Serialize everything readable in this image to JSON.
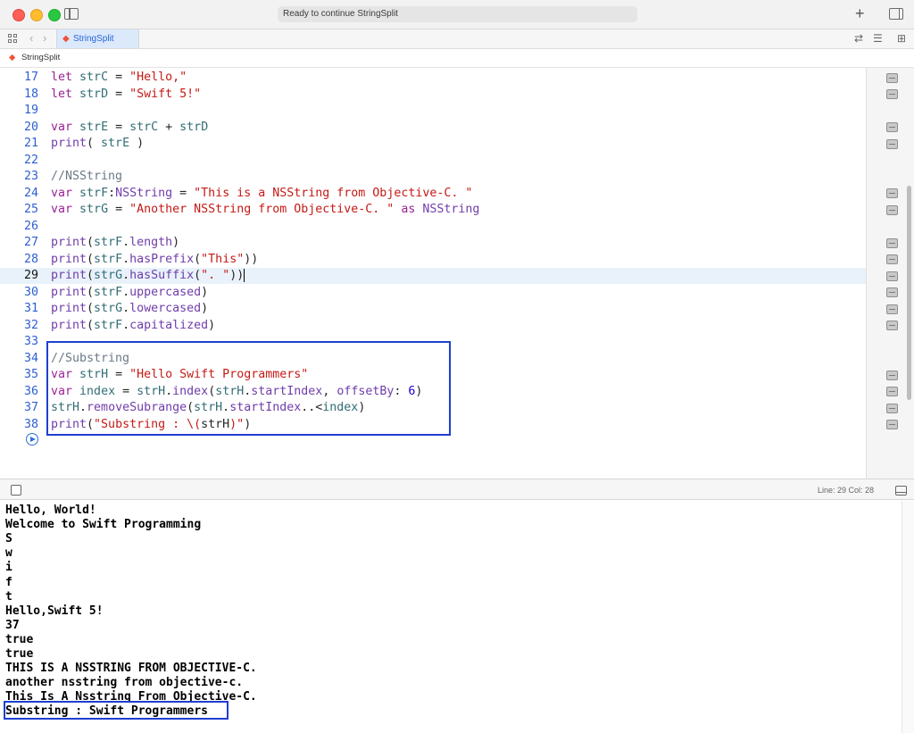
{
  "window": {
    "activity_status": "Ready to continue StringSplit",
    "tab_label": "StringSplit",
    "jump_bar": "StringSplit"
  },
  "editor": {
    "lines": [
      {
        "n": "17",
        "tokens": [
          [
            "kw",
            "let"
          ],
          [
            "p",
            " "
          ],
          [
            "id",
            "strC"
          ],
          [
            "p",
            " = "
          ],
          [
            "str",
            "\"Hello,\""
          ]
        ]
      },
      {
        "n": "18",
        "tokens": [
          [
            "kw",
            "let"
          ],
          [
            "p",
            " "
          ],
          [
            "id",
            "strD"
          ],
          [
            "p",
            " = "
          ],
          [
            "str",
            "\"Swift 5!\""
          ]
        ]
      },
      {
        "n": "19",
        "tokens": []
      },
      {
        "n": "20",
        "tokens": [
          [
            "kw",
            "var"
          ],
          [
            "p",
            " "
          ],
          [
            "id",
            "strE"
          ],
          [
            "p",
            " = "
          ],
          [
            "id",
            "strC"
          ],
          [
            "p",
            " + "
          ],
          [
            "id",
            "strD"
          ]
        ]
      },
      {
        "n": "21",
        "tokens": [
          [
            "ty",
            "print"
          ],
          [
            "p",
            "( "
          ],
          [
            "id",
            "strE"
          ],
          [
            "p",
            " )"
          ]
        ]
      },
      {
        "n": "22",
        "tokens": []
      },
      {
        "n": "23",
        "tokens": [
          [
            "cm",
            "//NSString"
          ]
        ]
      },
      {
        "n": "24",
        "tokens": [
          [
            "kw",
            "var"
          ],
          [
            "p",
            " "
          ],
          [
            "id",
            "strF"
          ],
          [
            "p",
            ":"
          ],
          [
            "ty",
            "NSString"
          ],
          [
            "p",
            " = "
          ],
          [
            "str",
            "\"This is a NSString from Objective-C. \""
          ]
        ]
      },
      {
        "n": "25",
        "tokens": [
          [
            "kw",
            "var"
          ],
          [
            "p",
            " "
          ],
          [
            "id",
            "strG"
          ],
          [
            "p",
            " = "
          ],
          [
            "str",
            "\"Another NSString from Objective-C. \""
          ],
          [
            "p",
            " "
          ],
          [
            "kw",
            "as"
          ],
          [
            "p",
            " "
          ],
          [
            "ty",
            "NSString"
          ]
        ]
      },
      {
        "n": "26",
        "tokens": []
      },
      {
        "n": "27",
        "tokens": [
          [
            "ty",
            "print"
          ],
          [
            "p",
            "("
          ],
          [
            "id",
            "strF"
          ],
          [
            "p",
            "."
          ],
          [
            "ty",
            "length"
          ],
          [
            "p",
            ")"
          ]
        ]
      },
      {
        "n": "28",
        "tokens": [
          [
            "ty",
            "print"
          ],
          [
            "p",
            "("
          ],
          [
            "id",
            "strF"
          ],
          [
            "p",
            "."
          ],
          [
            "ty",
            "hasPrefix"
          ],
          [
            "p",
            "("
          ],
          [
            "str",
            "\"This\""
          ],
          [
            "p",
            "))"
          ]
        ]
      },
      {
        "n": "29",
        "tokens": [
          [
            "ty",
            "print"
          ],
          [
            "p",
            "("
          ],
          [
            "id",
            "strG"
          ],
          [
            "p",
            "."
          ],
          [
            "ty",
            "hasSuffix"
          ],
          [
            "p",
            "("
          ],
          [
            "str",
            "\". \""
          ],
          [
            "p",
            "))"
          ]
        ],
        "current": true
      },
      {
        "n": "30",
        "tokens": [
          [
            "ty",
            "print"
          ],
          [
            "p",
            "("
          ],
          [
            "id",
            "strF"
          ],
          [
            "p",
            "."
          ],
          [
            "ty",
            "uppercased"
          ],
          [
            "p",
            ")"
          ]
        ]
      },
      {
        "n": "31",
        "tokens": [
          [
            "ty",
            "print"
          ],
          [
            "p",
            "("
          ],
          [
            "id",
            "strG"
          ],
          [
            "p",
            "."
          ],
          [
            "ty",
            "lowercased"
          ],
          [
            "p",
            ")"
          ]
        ]
      },
      {
        "n": "32",
        "tokens": [
          [
            "ty",
            "print"
          ],
          [
            "p",
            "("
          ],
          [
            "id",
            "strF"
          ],
          [
            "p",
            "."
          ],
          [
            "ty",
            "capitalized"
          ],
          [
            "p",
            ")"
          ]
        ]
      },
      {
        "n": "33",
        "tokens": []
      },
      {
        "n": "34",
        "tokens": [
          [
            "cm",
            "//Substring"
          ]
        ]
      },
      {
        "n": "35",
        "tokens": [
          [
            "kw",
            "var"
          ],
          [
            "p",
            " "
          ],
          [
            "id",
            "strH"
          ],
          [
            "p",
            " = "
          ],
          [
            "str",
            "\"Hello Swift Programmers\""
          ]
        ]
      },
      {
        "n": "36",
        "tokens": [
          [
            "kw",
            "var"
          ],
          [
            "p",
            " "
          ],
          [
            "id",
            "index"
          ],
          [
            "p",
            " = "
          ],
          [
            "id",
            "strH"
          ],
          [
            "p",
            "."
          ],
          [
            "ty",
            "index"
          ],
          [
            "p",
            "("
          ],
          [
            "id",
            "strH"
          ],
          [
            "p",
            "."
          ],
          [
            "ty",
            "startIndex"
          ],
          [
            "p",
            ", "
          ],
          [
            "ty",
            "offsetBy"
          ],
          [
            "p",
            ": "
          ],
          [
            "num",
            "6"
          ],
          [
            "p",
            ")"
          ]
        ]
      },
      {
        "n": "37",
        "tokens": [
          [
            "id",
            "strH"
          ],
          [
            "p",
            "."
          ],
          [
            "ty",
            "removeSubrange"
          ],
          [
            "p",
            "("
          ],
          [
            "id",
            "strH"
          ],
          [
            "p",
            "."
          ],
          [
            "ty",
            "startIndex"
          ],
          [
            "p",
            "..<"
          ],
          [
            "id",
            "index"
          ],
          [
            "p",
            ")"
          ]
        ]
      },
      {
        "n": "38",
        "tokens": [
          [
            "ty",
            "print"
          ],
          [
            "p",
            "("
          ],
          [
            "str",
            "\"Substring : \\("
          ],
          [
            "p",
            "strH"
          ],
          [
            "str",
            ")\""
          ],
          [
            "p",
            ")"
          ]
        ]
      }
    ],
    "result_button_lines": [
      "17",
      "18",
      "20",
      "21",
      "24",
      "25",
      "27",
      "28",
      "29",
      "30",
      "31",
      "32",
      "35",
      "36",
      "37",
      "38"
    ]
  },
  "status": {
    "line_col": "Line: 29  Col: 28"
  },
  "console": {
    "lines": [
      "Hello, World!",
      "Welcome to Swift Programming",
      "S",
      "w",
      "i",
      "f",
      "t",
      "Hello,Swift 5!",
      "37",
      "true",
      "true",
      "THIS IS A NSSTRING FROM OBJECTIVE-C.",
      "another nsstring from objective-c.",
      "This Is A Nsstring From Objective-C.",
      "Substring : Swift Programmers"
    ]
  },
  "colors": {
    "keyword": "#9b2393",
    "string": "#c41a16",
    "identifier": "#326d74",
    "comment": "#6c7986",
    "number": "#1c00cf",
    "type": "#703daa",
    "highlight_box": "#1e3fcf",
    "line_number": "#2d5fd0"
  }
}
